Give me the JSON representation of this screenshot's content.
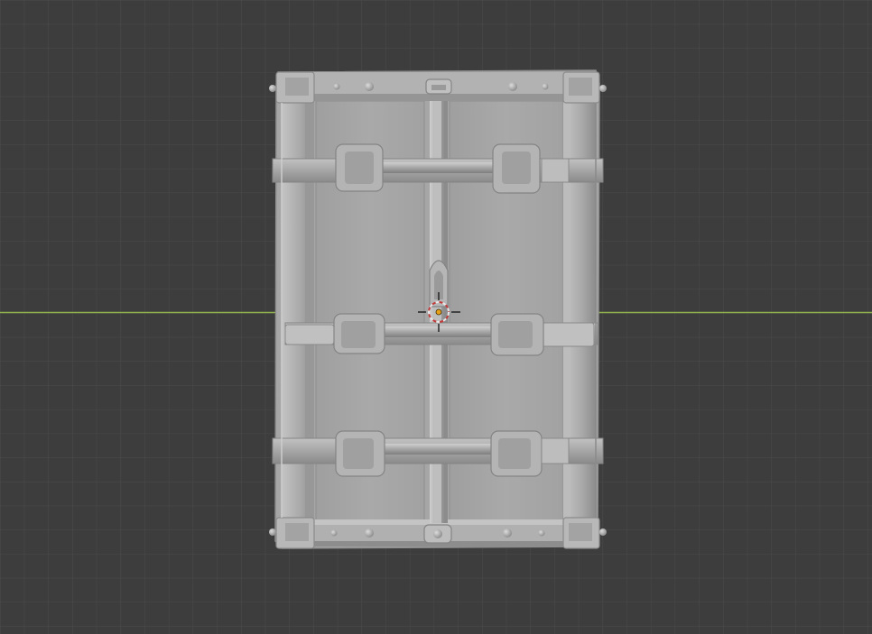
{
  "viewport": {
    "background_color": "#3d3d3d",
    "grid_minor_color": "#494949",
    "grid_major_color": "#575757",
    "x_axis_color": "#8fb04a"
  },
  "object": {
    "name": "trunk-mesh",
    "base_color": "#a8a8a8",
    "shadow_color": "#868686",
    "highlight_color": "#c6c6c6"
  },
  "cursor": {
    "ring_color_a": "#e8e8e8",
    "ring_color_b": "#c23b3b",
    "origin_color": "#e8a11a",
    "crosshair_color": "#111111"
  }
}
